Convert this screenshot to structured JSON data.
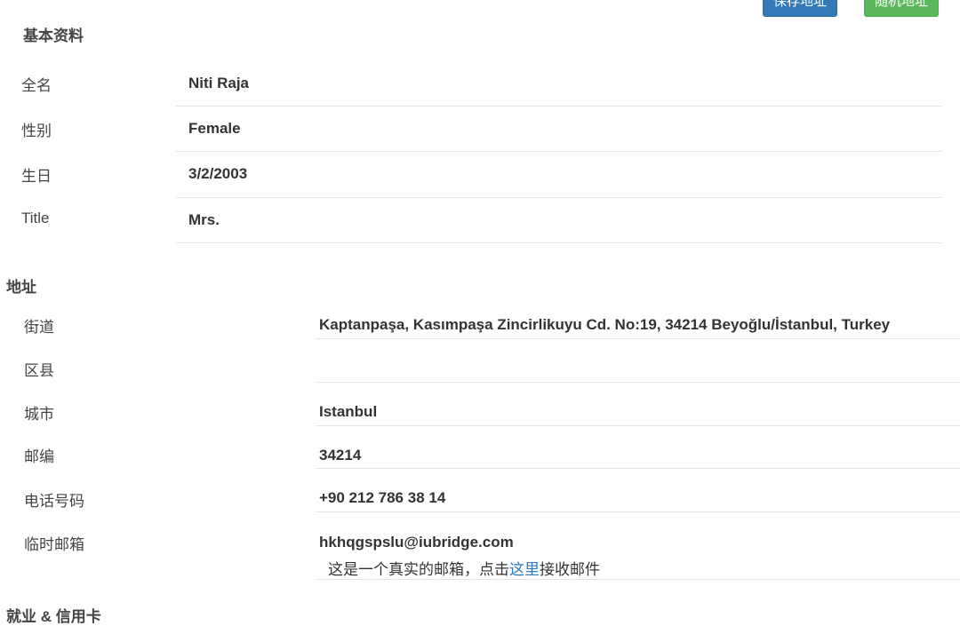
{
  "toolbar": {
    "save_label": "保存地址",
    "random_label": "随机地址"
  },
  "basic": {
    "title": "基本资料",
    "rows": [
      {
        "label": "全名",
        "value": "Niti Raja"
      },
      {
        "label": "性别",
        "value": "Female"
      },
      {
        "label": "生日",
        "value": "3/2/2003"
      },
      {
        "label": "Title",
        "value": "Mrs."
      }
    ]
  },
  "address": {
    "title": "地址",
    "rows": [
      {
        "label": "街道",
        "value": "Kaptanpaşa, Kasımpaşa Zincirlikuyu Cd. No:19, 34214 Beyoğlu/İstanbul, Turkey"
      },
      {
        "label": "区县",
        "value": ""
      },
      {
        "label": "城市",
        "value": "Istanbul"
      },
      {
        "label": "邮编",
        "value": "34214"
      },
      {
        "label": "电话号码",
        "value": "+90 212 786 38 14"
      },
      {
        "label": "临时邮箱",
        "value": "hkhqgspslu@iubridge.com"
      }
    ],
    "email_note": {
      "prefix": "这是一个真实的邮箱，点击",
      "link": "这里",
      "suffix": "接收邮件"
    }
  },
  "employment": {
    "title": "就业 & 信用卡"
  },
  "colors": {
    "primary": "#337ab7",
    "success": "#5cb85c",
    "link": "#337ab7"
  }
}
